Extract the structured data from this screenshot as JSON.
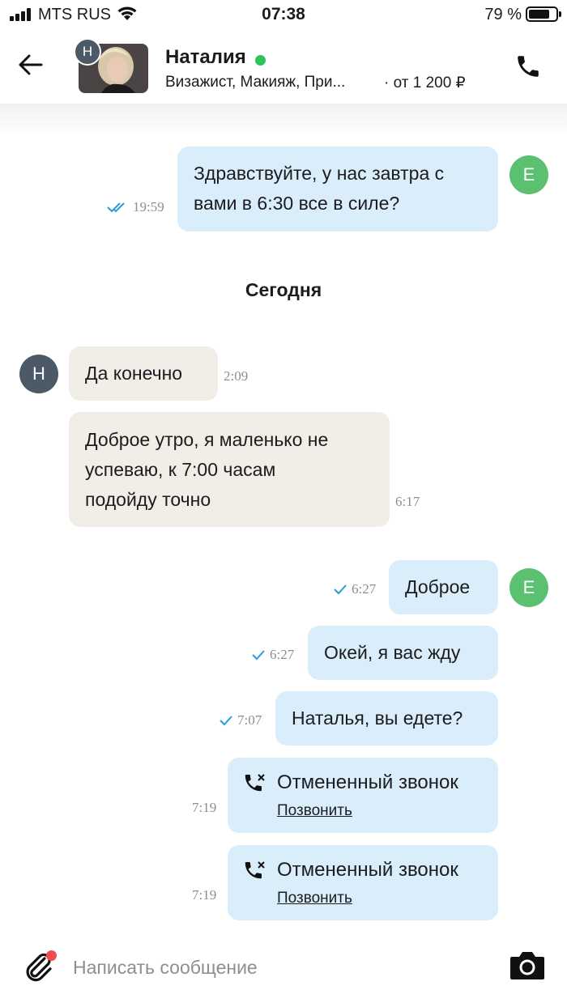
{
  "status_bar": {
    "carrier": "MTS RUS",
    "time": "07:38",
    "battery": "79 %",
    "battery_level": 0.79
  },
  "header": {
    "avatar_letter": "Н",
    "name": "Наталия",
    "services": "Визажист, Макияж, При...",
    "price": "· от 1 200 ₽",
    "online": true
  },
  "colors": {
    "outgoing_bubble": "#d9edfb",
    "incoming_bubble": "#f1eee8",
    "tick": "#2a9bd8",
    "online": "#2bc35a",
    "my_avatar": "#5bc06f",
    "contact_avatar": "#4b5a66"
  },
  "messages": [
    {
      "dir": "out",
      "text_lines": [
        "Здравствуйте, у нас завтра с",
        "вами в 6:30 все в силе?"
      ],
      "time": "19:59",
      "status": "read",
      "avatar": "Е"
    },
    {
      "divider": "Сегодня"
    },
    {
      "dir": "in",
      "text": "Да конечно",
      "time": "2:09",
      "avatar": "Н"
    },
    {
      "dir": "in",
      "text_lines": [
        "Доброе утро, я маленько не",
        "успеваю, к 7:00 часам",
        "подойду точно"
      ],
      "time": "6:17"
    },
    {
      "dir": "out",
      "text": "Доброе",
      "time": "6:27",
      "status": "sent",
      "avatar": "Е"
    },
    {
      "dir": "out",
      "text": "Окей, я вас жду",
      "time": "6:27",
      "status": "sent"
    },
    {
      "dir": "out",
      "text": "Наталья, вы едете?",
      "time": "7:07",
      "status": "sent"
    },
    {
      "dir": "out",
      "type": "call",
      "title": "Отмененный звонок",
      "action": "Позвонить",
      "time": "7:19"
    },
    {
      "dir": "out",
      "type": "call",
      "title": "Отмененный звонок",
      "action": "Позвонить",
      "time": "7:19"
    }
  ],
  "composer": {
    "placeholder": "Написать сообщение",
    "attach_icon": "paperclip-icon",
    "camera_icon": "camera-icon"
  }
}
